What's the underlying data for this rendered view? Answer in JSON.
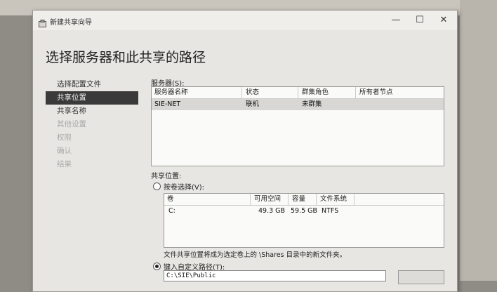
{
  "window": {
    "title": "新建共享向导",
    "minimize": "—",
    "maximize": "☐",
    "close": "✕",
    "heading": "选择服务器和此共享的路径"
  },
  "nav": {
    "items": [
      {
        "label": "选择配置文件",
        "state": "done"
      },
      {
        "label": "共享位置",
        "state": "selected"
      },
      {
        "label": "共享名称",
        "state": "normal"
      },
      {
        "label": "其他设置",
        "state": "disabled"
      },
      {
        "label": "权限",
        "state": "disabled"
      },
      {
        "label": "确认",
        "state": "disabled"
      },
      {
        "label": "结果",
        "state": "disabled"
      }
    ]
  },
  "servers": {
    "label": "服务器(S):",
    "columns": [
      "服务器名称",
      "状态",
      "群集角色",
      "所有者节点"
    ],
    "rows": [
      {
        "name": "SIE-NET",
        "status": "联机",
        "role": "未群集",
        "owner": ""
      }
    ]
  },
  "share_location": {
    "label": "共享位置:",
    "by_volume_label": "按卷选择(V):",
    "volume_columns": [
      "卷",
      "可用空间",
      "容量",
      "文件系统"
    ],
    "volumes": [
      {
        "volume": "C:",
        "free": "49.3 GB",
        "capacity": "59.5 GB",
        "fs": "NTFS"
      }
    ],
    "note": "文件共享位置将成为选定卷上的 \\Shares 目录中的新文件夹。",
    "custom_path_label": "键入自定义路径(T):",
    "custom_path_value": "C:\\SIE\\Public"
  }
}
